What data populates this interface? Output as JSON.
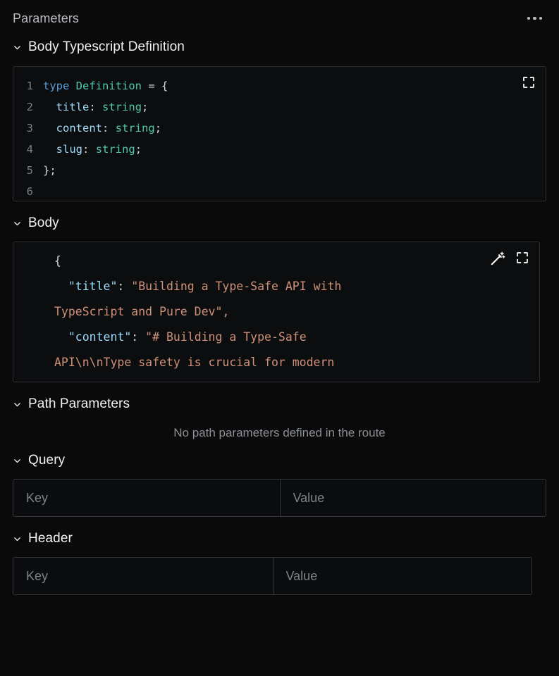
{
  "panel": {
    "title": "Parameters",
    "menu_icon": "ellipsis-horizontal-icon"
  },
  "sections": {
    "body_ts": {
      "label": "Body Typescript Definition",
      "chevron_icon": "chevron-down-icon",
      "expand_icon": "expand-fullscreen-icon",
      "code_lines": [
        {
          "n": "1",
          "text": "type Definition = {"
        },
        {
          "n": "2",
          "text": "  title: string;"
        },
        {
          "n": "3",
          "text": "  content: string;"
        },
        {
          "n": "4",
          "text": "  slug: string;"
        },
        {
          "n": "5",
          "text": "};"
        },
        {
          "n": "6",
          "text": ""
        }
      ]
    },
    "body": {
      "label": "Body",
      "chevron_icon": "chevron-down-icon",
      "magic_icon": "magic-wand-icon",
      "expand_icon": "expand-fullscreen-icon",
      "json_lines": [
        "{",
        "  \"title\": \"Building a Type-Safe API with",
        "TypeScript and Pure Dev\",",
        "  \"content\": \"# Building a Type-Safe",
        "API\\n\\nType safety is crucial for modern"
      ],
      "json_title_key": "\"title\"",
      "json_title_value": "\"Building a Type-Safe API with TypeScript and Pure Dev\",",
      "json_content_key": "\"content\"",
      "json_content_value": "\"# Building a Type-Safe API\\n\\nType safety is crucial for modern"
    },
    "path_parameters": {
      "label": "Path Parameters",
      "chevron_icon": "chevron-down-icon",
      "empty_text": "No path parameters defined in the route"
    },
    "query": {
      "label": "Query",
      "chevron_icon": "chevron-down-icon",
      "key_placeholder": "Key",
      "key_value": "",
      "value_placeholder": "Value",
      "value_value": ""
    },
    "header": {
      "label": "Header",
      "chevron_icon": "chevron-down-icon",
      "key_placeholder": "Key",
      "key_value": "",
      "value_placeholder": "Value",
      "value_value": ""
    }
  },
  "theme": {
    "background": "#0a0a0b",
    "code_background": "#0c0d0f",
    "border": "#2c2d30",
    "text_primary": "#f1f2f3",
    "text_muted": "#8b8f96",
    "token_keyword": "#569cd6",
    "token_type": "#4ec9b0",
    "token_property": "#9cdcfe",
    "token_string": "#ce9178"
  }
}
